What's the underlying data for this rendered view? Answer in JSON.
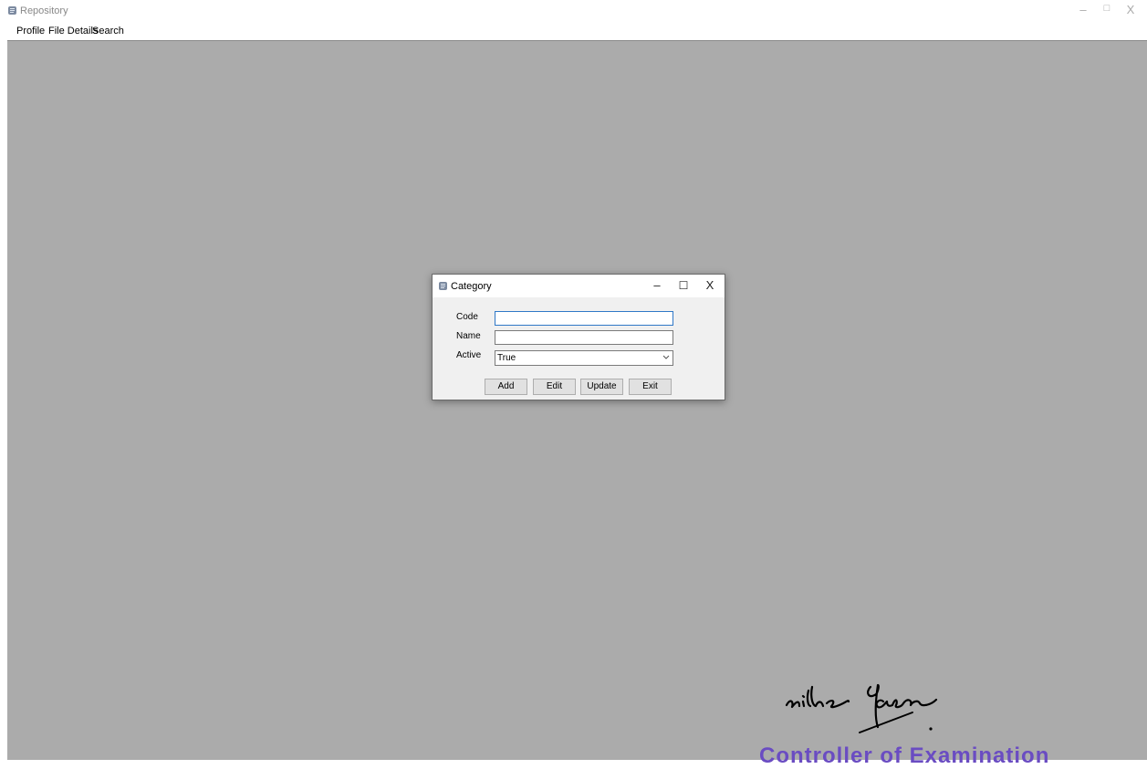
{
  "window": {
    "title": "Repository",
    "minimize_glyph": "–",
    "maximize_glyph": "□",
    "close_glyph": "X",
    "icon": "scroll-icon"
  },
  "menubar": {
    "items": [
      {
        "label": "Profile"
      },
      {
        "label": "File Details"
      },
      {
        "label": "Search"
      }
    ]
  },
  "dialog": {
    "title": "Category",
    "icon": "scroll-icon",
    "minimize_glyph": "–",
    "maximize_glyph": "☐",
    "close_glyph": "X",
    "fields": {
      "code": {
        "label": "Code",
        "value": ""
      },
      "name": {
        "label": "Name",
        "value": ""
      },
      "active": {
        "label": "Active",
        "value": "True"
      }
    },
    "buttons": {
      "add": "Add",
      "edit": "Edit",
      "update": "Update",
      "exit": "Exit"
    }
  },
  "overlay": {
    "stamp_text": "Controller of Examination"
  },
  "colors": {
    "mdi_background": "#ababab",
    "dialog_background": "#f0f0f0",
    "focus_border": "#2f78c7",
    "stamp": "#6a4cc2"
  }
}
